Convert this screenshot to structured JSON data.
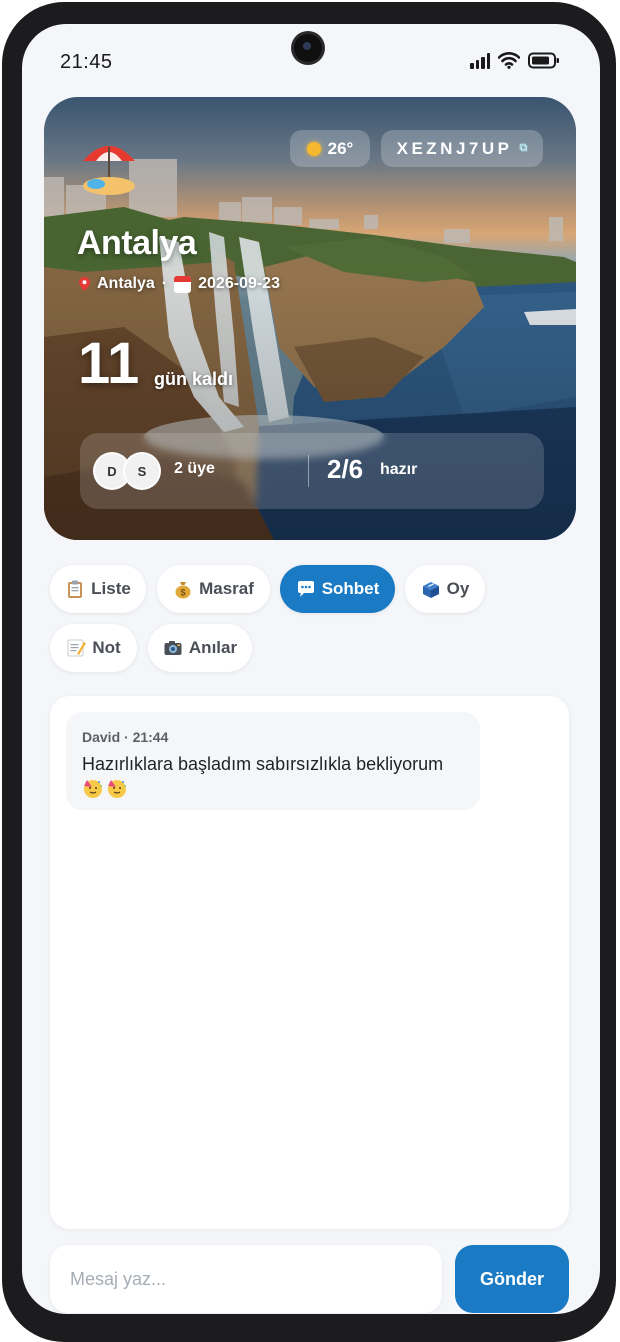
{
  "status_bar": {
    "time": "21:45"
  },
  "hero": {
    "weather": "26°",
    "invite_code": "XEZNJ7UP",
    "title": "Antalya",
    "location": "Antalya",
    "separator": "·",
    "date": "2026-09-23",
    "countdown_value": "11",
    "countdown_label": "gün kaldı",
    "members": [
      {
        "initial": "D"
      },
      {
        "initial": "S"
      }
    ],
    "member_count": "2 üye",
    "ready_value": "2/6",
    "ready_label": "hazır"
  },
  "tabs": [
    {
      "label": "Liste",
      "icon": "clipboard-icon"
    },
    {
      "label": "Masraf",
      "icon": "money-bag-icon"
    },
    {
      "label": "Sohbet",
      "icon": "speech-bubble-icon",
      "active": true
    },
    {
      "label": "Oy",
      "icon": "ballot-box-icon"
    },
    {
      "label": "Not",
      "icon": "memo-icon"
    },
    {
      "label": "Anılar",
      "icon": "camera-icon"
    }
  ],
  "chat": {
    "messages": [
      {
        "meta": "David · 21:44",
        "text": "Hazırlıklara başladım sabırsızlıkla bekliyorum",
        "emoji": "party-face-icon"
      }
    ]
  },
  "composer": {
    "placeholder": "Mesaj yaz...",
    "send_label": "Gönder"
  },
  "colors": {
    "accent": "#1a7bc4",
    "background": "#f4f6f9"
  }
}
